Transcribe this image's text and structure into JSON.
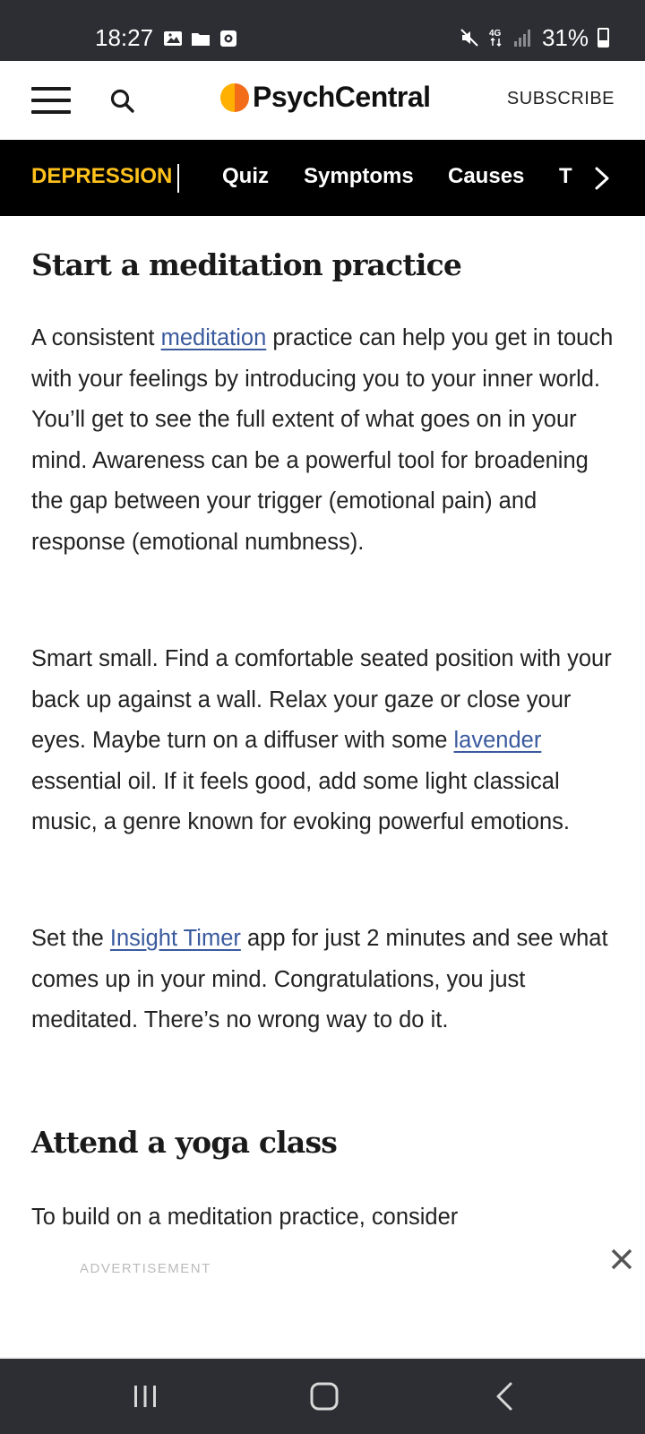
{
  "status_bar": {
    "time": "18:27",
    "battery": "31%",
    "battery_level": 0.31,
    "icons": [
      "gallery-icon",
      "folder-icon",
      "screenshot-app-icon",
      "mute-icon",
      "network-4g-icon",
      "signal-icon",
      "battery-icon"
    ]
  },
  "header": {
    "logo_text": "PsychCentral",
    "subscribe_label": "SUBSCRIBE",
    "icons": [
      "hamburger-menu-icon",
      "search-icon"
    ]
  },
  "topic_nav": {
    "title": "DEPRESSION",
    "items": [
      {
        "label": "Quiz"
      },
      {
        "label": "Symptoms"
      },
      {
        "label": "Causes"
      },
      {
        "label": "T"
      }
    ],
    "next_icon": "chevron-right-icon"
  },
  "article": {
    "section1": {
      "heading": "Start a meditation practice",
      "p1": {
        "before": "A consistent ",
        "link": "meditation",
        "after": " practice can help you get in touch with your feelings by introducing you to your inner world. You’ll get to see the full extent of what goes on in your mind. Awareness can be a powerful tool for broadening the gap between your trigger (emotional pain) and response (emotional numbness)."
      },
      "p2": {
        "before": "Smart small. Find a comfortable seated position with your back up against a wall. Relax your gaze or close your eyes. Maybe turn on a diffuser with some ",
        "link": "lavender",
        "after": " essential oil. If it feels good, add some light classical music, a genre known for evoking powerful emotions."
      },
      "p3": {
        "before": "Set the ",
        "link": "Insight Timer",
        "after": " app for just 2 minutes and see what comes up in your mind. Congratulations, you just meditated. There’s no wrong way to do it."
      }
    },
    "section2": {
      "heading": "Attend a yoga class",
      "p1": "To build on a meditation practice, consider"
    }
  },
  "ad": {
    "label": "ADVERTISEMENT",
    "close_icon": "close-icon"
  },
  "android_nav": {
    "buttons": [
      "recent-apps-icon",
      "home-icon",
      "back-icon"
    ]
  },
  "colors": {
    "status_bar": "#2d2e33",
    "topic_nav_bg": "#000000",
    "topic_title": "#ffc11c",
    "link": "#3a5a9e",
    "logo_yellow": "#ffb000",
    "logo_orange": "#f26c1a"
  }
}
